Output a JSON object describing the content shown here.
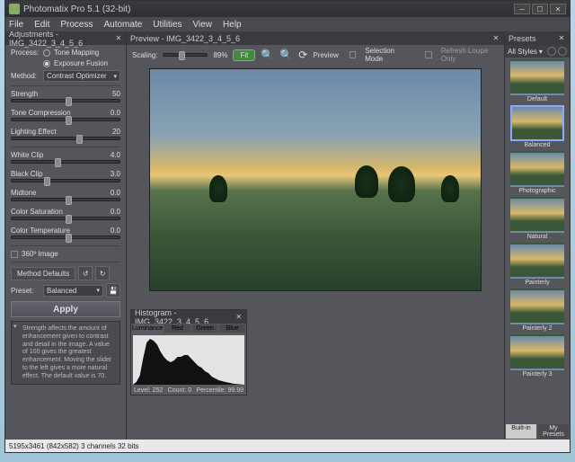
{
  "window": {
    "title": "Photomatix Pro 5.1 (32-bit)"
  },
  "menu": [
    "File",
    "Edit",
    "Process",
    "Automate",
    "Utilities",
    "View",
    "Help"
  ],
  "adjust": {
    "title": "Adjustments - IMG_3422_3_4_5_6",
    "process_label": "Process:",
    "process_tone": "Tone Mapping",
    "process_fusion": "Exposure Fusion",
    "method_label": "Method:",
    "method_value": "Contrast Optimizer",
    "sliders": [
      {
        "name": "Strength",
        "value": "50",
        "pos": 50
      },
      {
        "name": "Tone Compression",
        "value": "0.0",
        "pos": 50
      },
      {
        "name": "Lighting Effect",
        "value": "20",
        "pos": 60
      },
      {
        "name": "White Clip",
        "value": "4.0",
        "pos": 40
      },
      {
        "name": "Black Clip",
        "value": "3.0",
        "pos": 30
      },
      {
        "name": "Midtone",
        "value": "0.0",
        "pos": 50
      },
      {
        "name": "Color Saturation",
        "value": "0.0",
        "pos": 50
      },
      {
        "name": "Color Temperature",
        "value": "0.0",
        "pos": 50
      }
    ],
    "image360": "360º Image",
    "defaults_btn": "Method Defaults",
    "preset_label": "Preset:",
    "preset_value": "Balanced",
    "apply": "Apply",
    "help": "Strength affects the amount of enhancement given to contrast and detail in the image. A value of 100 gives the greatest enhancement. Moving the slider to the left gives a more natural effect. The default value is 70."
  },
  "preview": {
    "title": "Preview - IMG_3422_3_4_5_6",
    "scaling": "Scaling:",
    "scaling_pct": "89%",
    "fit": "Fit",
    "sel_mode": "Selection Mode",
    "refresh_loupe": "Refresh Loupe Only",
    "preview_label": "Preview"
  },
  "hist": {
    "title": "Histogram - IMG_3422_3_4_5_6",
    "tabs": [
      "Luminance",
      "Red",
      "Green",
      "Blue"
    ],
    "level_l": "Level:",
    "level_v": "252",
    "count_l": "Count:",
    "count_v": "0",
    "perc_l": "Percentile:",
    "perc_v": "99.99"
  },
  "presets": {
    "title": "Presets",
    "styles_label": "All Styles",
    "items": [
      "Default",
      "Balanced",
      "Photographic",
      "Natural",
      "Painterly",
      "Painterly 2",
      "Painterly 3"
    ],
    "tabs": [
      "Built-in",
      "My Presets"
    ]
  },
  "status": "5195x3461 (842x582) 3 channels 32 bits"
}
